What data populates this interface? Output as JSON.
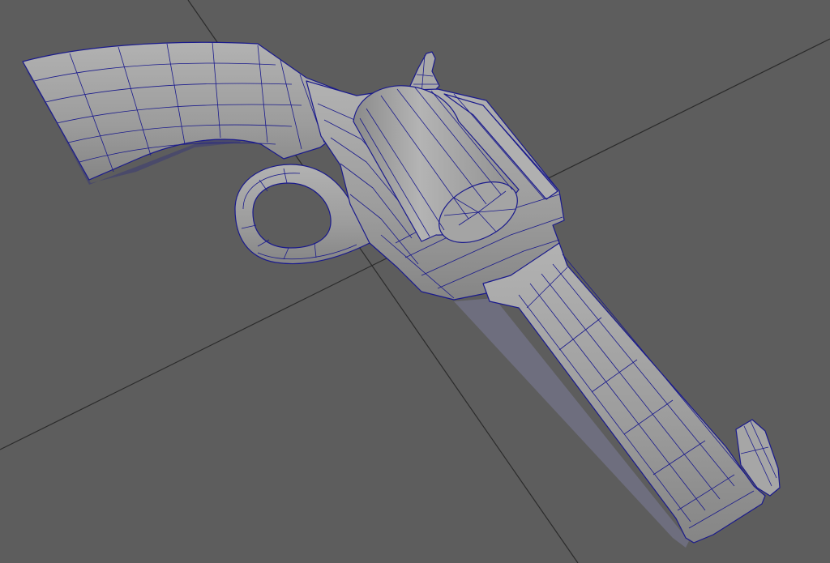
{
  "viewport": {
    "kind": "3d-modeling-viewport",
    "background_color": "#5d5d5d",
    "grid_line_color": "#2b2b2b"
  },
  "model": {
    "name": "revolver",
    "display_mode": "wireframe-on-shaded",
    "surface_color": "#9e9e9e",
    "wire_color": "#1a1a8c",
    "parts": [
      "grip",
      "hammer",
      "trigger-guard",
      "cylinder",
      "frame",
      "barrel",
      "front-sight"
    ]
  }
}
